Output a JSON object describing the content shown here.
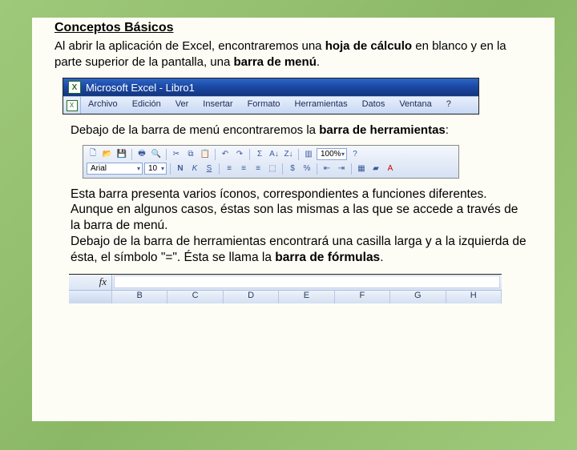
{
  "heading": "Conceptos Básicos",
  "intro_pre": "Al abrir la aplicación de Excel, encontraremos una ",
  "intro_bold1": "hoja de cálculo",
  "intro_mid": " en blanco y en la parte superior de la pantalla, una ",
  "intro_bold2": "barra de menú",
  "intro_end": ".",
  "titlebar": "Microsoft Excel - Libro1",
  "menu": {
    "archivo": "Archivo",
    "edicion": "Edición",
    "ver": "Ver",
    "insertar": "Insertar",
    "formato": "Formato",
    "herramientas": "Herramientas",
    "datos": "Datos",
    "ventana": "Ventana",
    "ayuda": "?"
  },
  "para2_pre": "Debajo de la barra de menú encontraremos la ",
  "para2_bold": "barra de herramientas",
  "para2_end": ":",
  "toolbar": {
    "font": "Arial",
    "size": "10",
    "zoom": "100%"
  },
  "body_p1": "Esta barra presenta varios íconos, correspondientes a funciones diferentes. Aunque en algunos casos, éstas son las mismas a las que se accede a través de la barra de menú.",
  "body_p2_pre": "Debajo de la barra de herramientas encontrará una casilla larga y a la izquierda de ésta, el símbolo \"=\". Ésta se llama la ",
  "body_p2_bold": "barra de fórmulas",
  "body_p2_end": ".",
  "fx": "fx",
  "cols": {
    "b": "B",
    "c": "C",
    "d": "D",
    "e": "E",
    "f": "F",
    "g": "G",
    "h": "H"
  }
}
